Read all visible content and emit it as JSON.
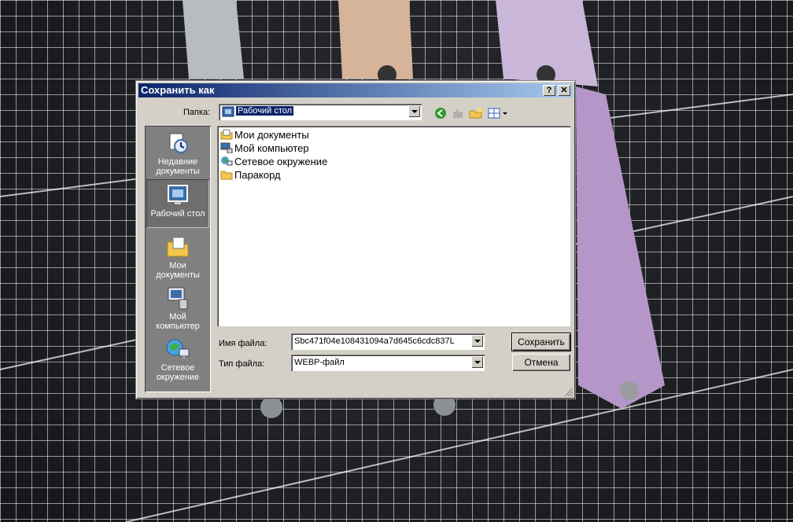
{
  "dialog": {
    "title": "Сохранить как",
    "help_glyph": "?",
    "close_glyph": "✕",
    "folder_label": "Папка:",
    "folder_value": "Рабочий стол",
    "places": [
      {
        "label": "Недавние документы",
        "icon": "recent-documents-icon"
      },
      {
        "label": "Рабочий стол",
        "icon": "desktop-icon"
      },
      {
        "label": "Мои документы",
        "icon": "my-documents-icon"
      },
      {
        "label": "Мой компьютер",
        "icon": "my-computer-icon"
      },
      {
        "label": "Сетевое окружение",
        "icon": "network-places-icon"
      }
    ],
    "files": [
      {
        "name": "Мои документы",
        "icon": "my-documents-icon"
      },
      {
        "name": "Мой компьютер",
        "icon": "my-computer-icon"
      },
      {
        "name": "Сетевое окружение",
        "icon": "network-places-icon"
      },
      {
        "name": "Паракорд",
        "icon": "folder-icon"
      }
    ],
    "filename_label": "Имя файла:",
    "filename_value": "Sbc471f04e108431094a7d645c6cdc837L",
    "filetype_label": "Тип файла:",
    "filetype_value": "WEBP-файл",
    "save_button": "Сохранить",
    "cancel_button": "Отмена",
    "colors": {
      "titlebar_start": "#0a246a",
      "titlebar_end": "#a6caf0",
      "face": "#d4d0c8"
    }
  }
}
